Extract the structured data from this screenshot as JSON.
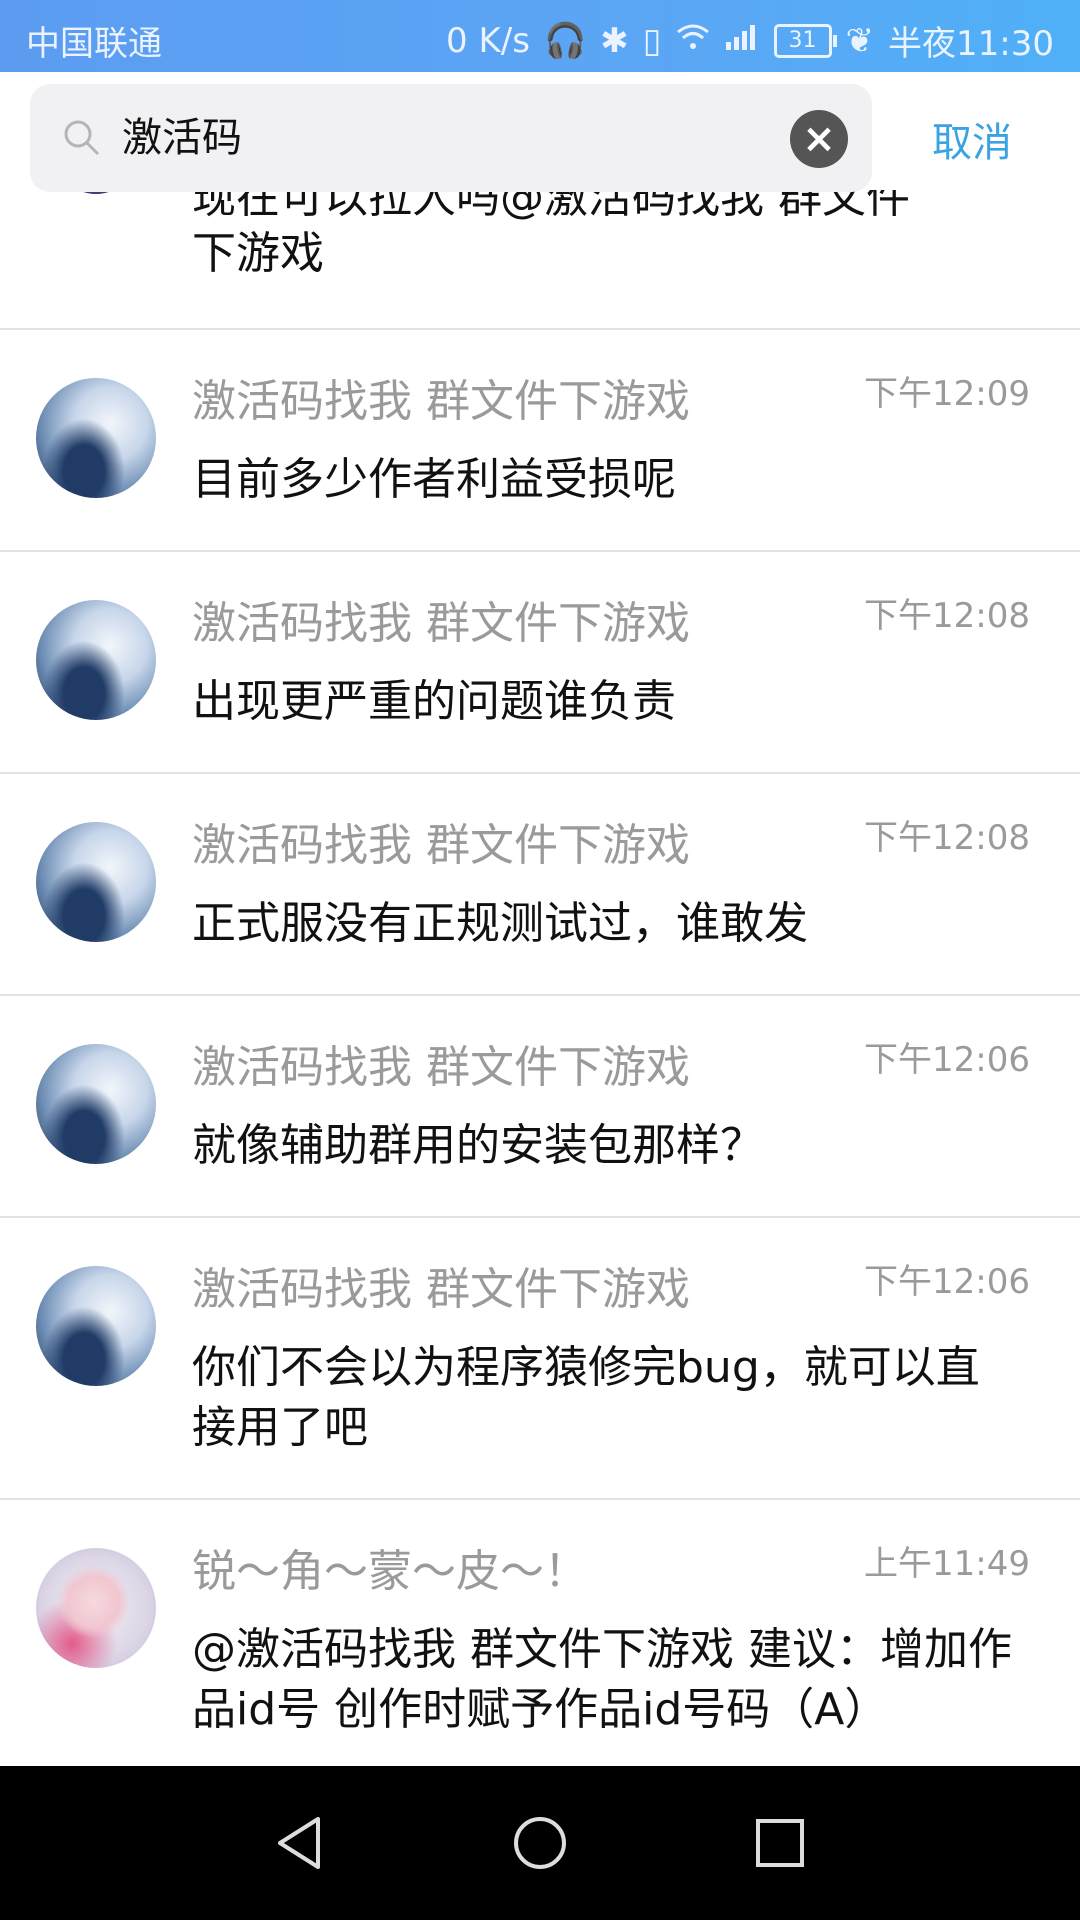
{
  "status_bar": {
    "carrier": "中国联通",
    "speed": "0 K/s",
    "battery": "31",
    "time": "半夜11:30"
  },
  "search": {
    "query": "激活码",
    "cancel_label": "取消"
  },
  "partial_message": {
    "text_line1": "现在可以拉人吗@激活码找我 群文件",
    "text_line2": "下游戏"
  },
  "messages": [
    {
      "sender": "激活码找我 群文件下游戏",
      "time": "下午12:09",
      "text": "目前多少作者利益受损呢"
    },
    {
      "sender": "激活码找我 群文件下游戏",
      "time": "下午12:08",
      "text": "出现更严重的问题谁负责"
    },
    {
      "sender": "激活码找我 群文件下游戏",
      "time": "下午12:08",
      "text": "正式服没有正规测试过，谁敢发"
    },
    {
      "sender": "激活码找我 群文件下游戏",
      "time": "下午12:06",
      "text": "就像辅助群用的安装包那样？"
    },
    {
      "sender": "激活码找我 群文件下游戏",
      "time": "下午12:06",
      "text": "你们不会以为程序猿修完bug，就可以直接用了吧"
    },
    {
      "sender": "锐～角～蒙～皮～！",
      "time": "上午11:49",
      "text": "@激活码找我 群文件下游戏 建议：增加作品id号 创作时赋予作品id号码（A）"
    }
  ],
  "colors": {
    "status_bar": "#5ba6f5",
    "accent": "#3aa3e3",
    "secondary_text": "#9a9a9a"
  }
}
